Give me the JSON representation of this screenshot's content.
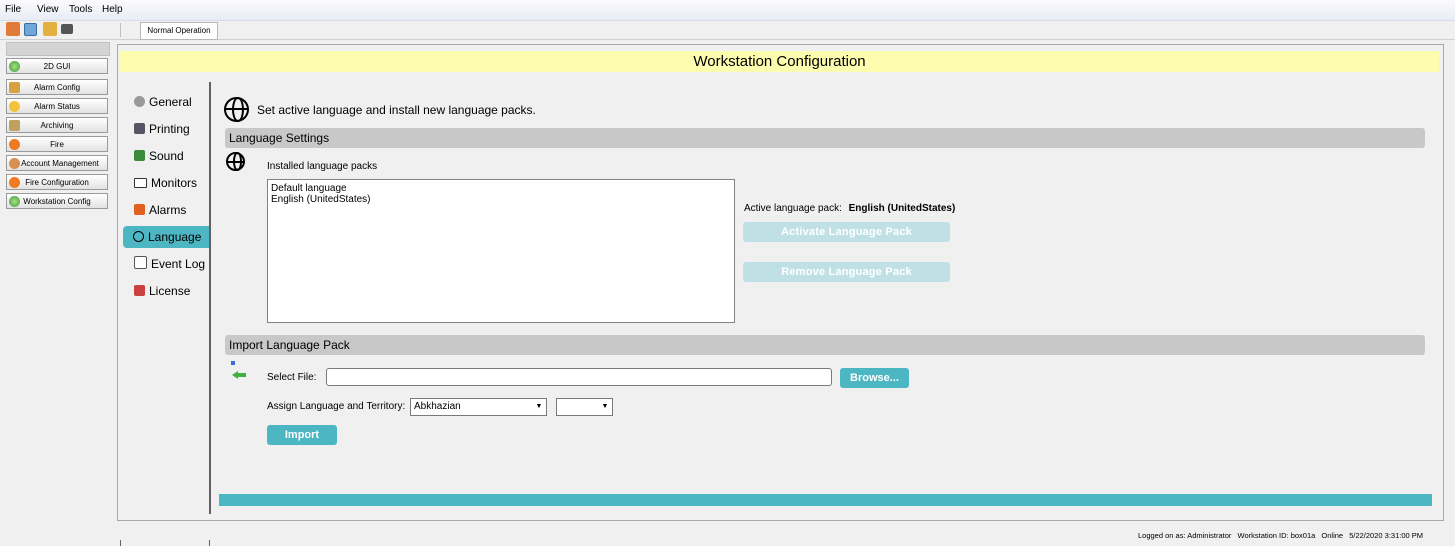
{
  "menu": {
    "file": "File",
    "view": "View",
    "tools": "Tools",
    "help": "Help"
  },
  "toolbar": {
    "mode_tab": "Normal Operation",
    "icons": [
      "user-icon",
      "play-icon",
      "home-icon",
      "binoculars-icon"
    ]
  },
  "nav": {
    "items": [
      {
        "label": "2D GUI",
        "icon": "globe-icon"
      },
      {
        "label": "Alarm Config",
        "icon": "wrench-icon"
      },
      {
        "label": "Alarm Status",
        "icon": "sun-icon"
      },
      {
        "label": "Archiving",
        "icon": "archive-icon"
      },
      {
        "label": "Fire",
        "icon": "fire-icon"
      },
      {
        "label": "Account Management",
        "icon": "users-icon"
      },
      {
        "label": "Fire Configuration",
        "icon": "fire-icon"
      },
      {
        "label": "Workstation Config",
        "icon": "globe-icon"
      }
    ]
  },
  "page": {
    "title": "Workstation Configuration"
  },
  "categories": [
    {
      "label": "General",
      "icon": "gear-icon"
    },
    {
      "label": "Printing",
      "icon": "printer-icon"
    },
    {
      "label": "Sound",
      "icon": "sound-icon"
    },
    {
      "label": "Monitors",
      "icon": "monitor-icon"
    },
    {
      "label": "Alarms",
      "icon": "alarm-icon"
    },
    {
      "label": "Language",
      "icon": "globe-icon",
      "active": true
    },
    {
      "label": "Event Log",
      "icon": "event-log-icon"
    },
    {
      "label": "License",
      "icon": "license-icon"
    }
  ],
  "language": {
    "description": "Set active language and install new language packs.",
    "settings_header": "Language Settings",
    "installed_label": "Installed language packs",
    "installed_packs": [
      "Default language",
      "English (UnitedStates)"
    ],
    "active_label": "Active language pack:",
    "active_value": "English (UnitedStates)",
    "activate_button": "Activate Language Pack",
    "remove_button": "Remove Language Pack",
    "import_header": "Import Language Pack",
    "select_file_label": "Select File:",
    "select_file_value": "",
    "browse_button": "Browse...",
    "assign_label": "Assign Language and Territory:",
    "language_select": "Abkhazian",
    "territory_select": "",
    "import_button": "Import"
  },
  "status": {
    "logged_on": "Logged on as: Administrator",
    "workstation": "Workstation ID: box01a",
    "online": "Online",
    "datetime": "5/22/2020 3:31:00 PM"
  },
  "colors": {
    "accent": "#4db6c3",
    "title_bg": "#fdfdb0",
    "disabled_button": "#bfe1e6"
  }
}
